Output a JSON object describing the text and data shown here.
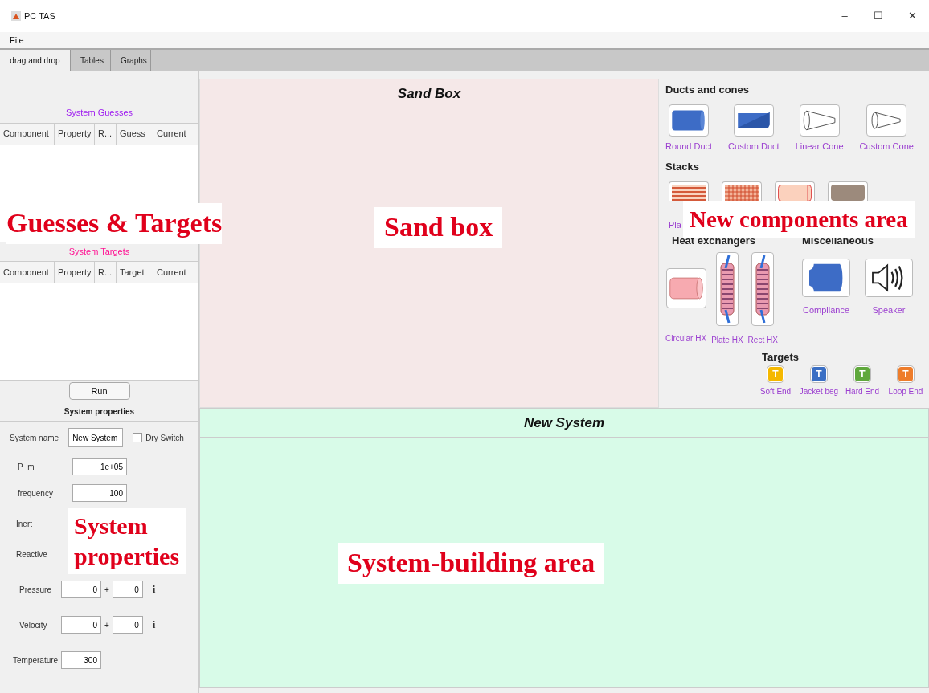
{
  "window": {
    "title": "PC TAS",
    "controls": [
      "–",
      "☐",
      "✕"
    ]
  },
  "menu": [
    "File"
  ],
  "tabs": [
    {
      "label": "drag and drop",
      "selected": true
    },
    {
      "label": "Tables",
      "selected": false
    },
    {
      "label": "Graphs",
      "selected": false
    }
  ],
  "guesses": {
    "title": "System Guesses",
    "columns": [
      "Component",
      "Property",
      "R...",
      "Guess",
      "Current"
    ]
  },
  "targets": {
    "title": "System Targets",
    "columns": [
      "Component",
      "Property",
      "R...",
      "Target",
      "Current"
    ]
  },
  "run_button": "Run",
  "system_properties": {
    "title": "System properties",
    "rows": [
      {
        "kind": "name",
        "label": "System name",
        "value": "New System",
        "checkbox": {
          "label": "Dry Switch",
          "checked": false
        }
      },
      {
        "kind": "single",
        "label": "P_m",
        "value": "1e+05"
      },
      {
        "kind": "single",
        "label": "frequency",
        "value": "100"
      },
      {
        "kind": "plain",
        "label": "Inert"
      },
      {
        "kind": "plain",
        "label": "Reactive"
      },
      {
        "kind": "complex",
        "label": "Pressure",
        "real": "0",
        "sep": "+",
        "imag": "0",
        "info": "i"
      },
      {
        "kind": "complex",
        "label": "Velocity",
        "real": "0",
        "sep": "+",
        "imag": "0",
        "info": "i"
      },
      {
        "kind": "short",
        "label": "Temperature",
        "value": "300"
      }
    ]
  },
  "sandbox": {
    "title": "Sand Box"
  },
  "new_system": {
    "title": "New System"
  },
  "components": {
    "ducts": {
      "title": "Ducts and cones",
      "items": [
        {
          "kind": "round-duct",
          "label": "Round Duct"
        },
        {
          "kind": "custom-duct",
          "label": "Custom Duct"
        },
        {
          "kind": "linear-cone",
          "label": "Linear Cone"
        },
        {
          "kind": "custom-cone",
          "label": "Custom Cone"
        }
      ]
    },
    "stacks": {
      "title": "Stacks",
      "items": [
        {
          "kind": "plate-stack",
          "label": "Pla"
        },
        {
          "kind": "grid-stack"
        },
        {
          "kind": "circular-stack"
        },
        {
          "kind": "porous-stack"
        }
      ]
    },
    "heat_exchangers": {
      "title": "Heat exchangers",
      "items": [
        {
          "kind": "circular-hx",
          "label": "Circular HX"
        },
        {
          "kind": "plate-hx",
          "label": "Plate HX"
        },
        {
          "kind": "rect-hx",
          "label": "Rect HX"
        }
      ]
    },
    "miscellaneous": {
      "title": "Miscellaneous",
      "items": [
        {
          "kind": "compliance",
          "label": "Compliance"
        },
        {
          "kind": "speaker",
          "label": "Speaker"
        }
      ]
    },
    "targets": {
      "title": "Targets",
      "items": [
        {
          "letter": "T",
          "label": "Soft End",
          "color": "#f5b800"
        },
        {
          "letter": "T",
          "label": "Jacket beg",
          "color": "#3b6fc4"
        },
        {
          "letter": "T",
          "label": "Hard End",
          "color": "#5fa83c"
        },
        {
          "letter": "T",
          "label": "Loop End",
          "color": "#ee7d2b"
        }
      ]
    }
  },
  "annotations": [
    {
      "kind": "guesses",
      "text": "Guesses & Targets"
    },
    {
      "kind": "sandbox",
      "text": "Sand box"
    },
    {
      "kind": "components",
      "text": "New components area"
    },
    {
      "kind": "properties",
      "text": "System\nproperties"
    },
    {
      "kind": "building",
      "text": "System-building area"
    }
  ]
}
